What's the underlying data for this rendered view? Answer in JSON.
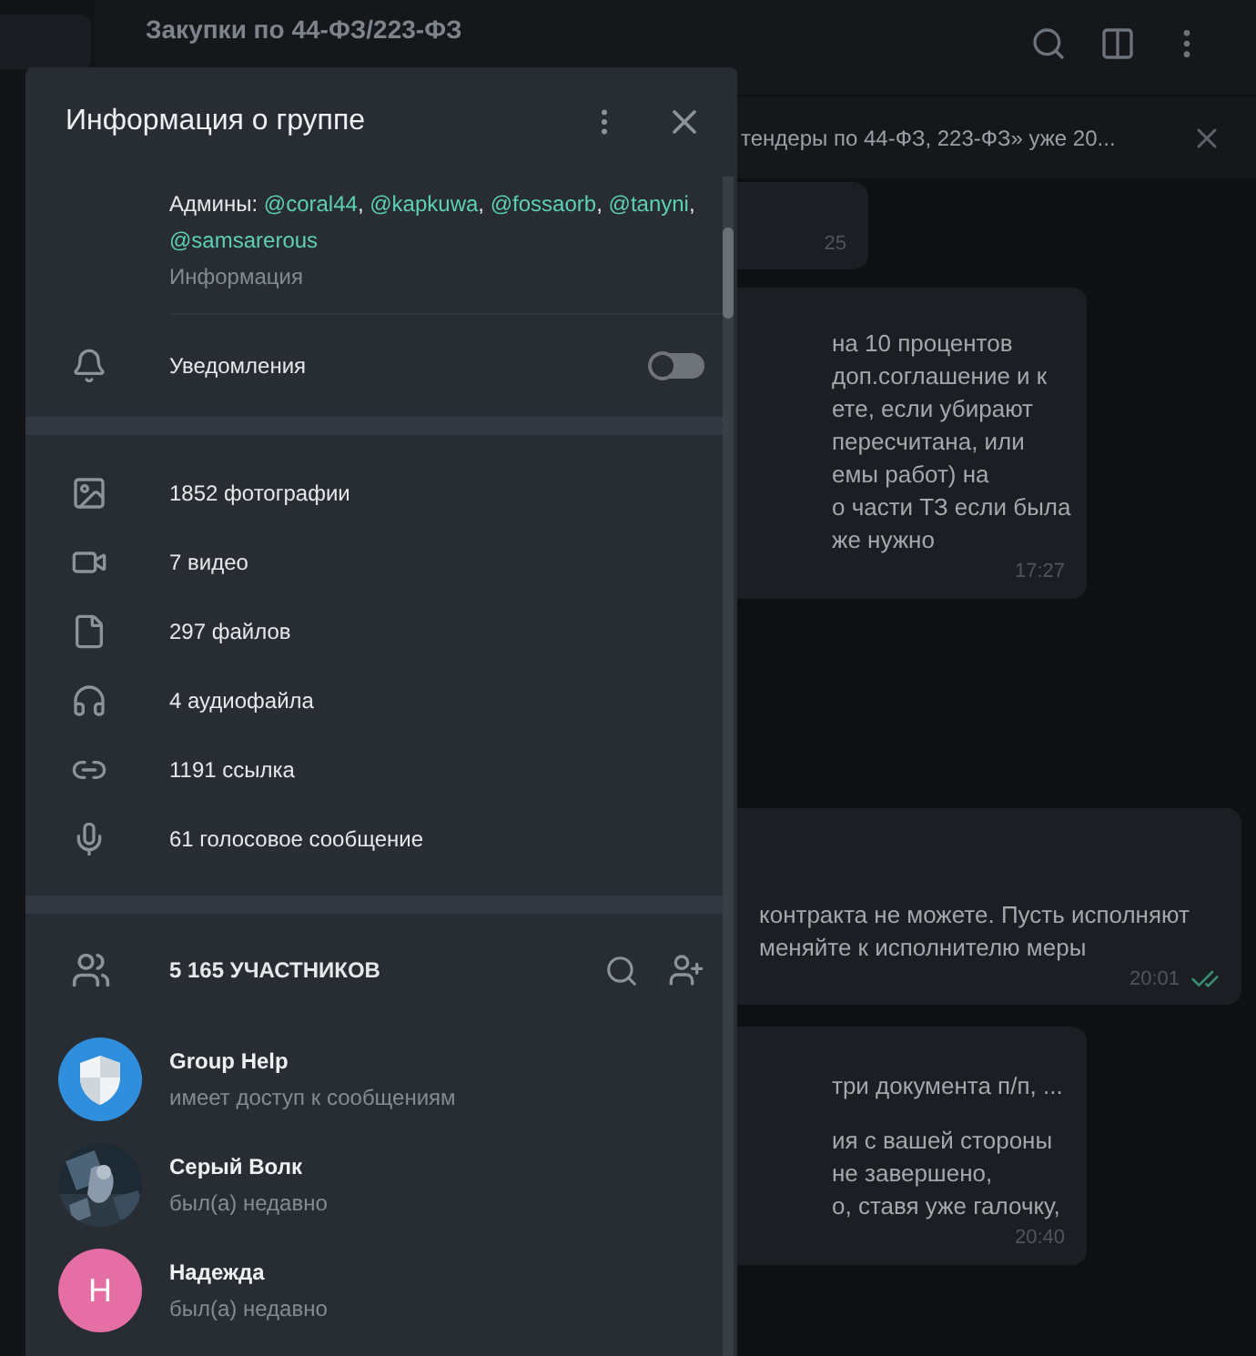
{
  "chat_header": {
    "title": "Закупки по 44-ФЗ/223-ФЗ"
  },
  "pinned": {
    "text": "тендеры по 44-ФЗ, 223-ФЗ» уже 20..."
  },
  "messages": [
    {
      "time": "25",
      "read": false
    },
    {
      "lines": [
        "на 10 процентов",
        "доп.соглашение и к",
        "ете, если убирают",
        "пересчитана, или",
        "емы работ) на",
        "о части ТЗ если была",
        "же нужно"
      ],
      "time": "17:27",
      "read": false
    },
    {
      "lines": [
        "контракта не можете. Пусть исполняют",
        "меняйте к исполнителю меры"
      ],
      "time": "20:01",
      "read": true
    },
    {
      "lines": [
        "три документа п/п, ...",
        "ия с вашей стороны",
        "не завершено,",
        "о, ставя уже галочку,"
      ],
      "time": "20:40",
      "read": false
    }
  ],
  "group_info": {
    "title": "Информация о группе",
    "admins": {
      "label": "Админы:",
      "handles": [
        "@coral44",
        "@kapkuwa",
        "@fossaorb",
        "@tanyni",
        "@samsarerous"
      ],
      "separator": ","
    },
    "info_label": "Информация",
    "notifications": {
      "label": "Уведомления",
      "on": false
    },
    "media": [
      {
        "label": "1852 фотографии"
      },
      {
        "kind": "video",
        "label": "7 видео"
      },
      {
        "kind": "file",
        "label": "297 файлов"
      },
      {
        "kind": "audio",
        "label": "4 аудиофайла"
      },
      {
        "kind": "link",
        "label": "1191 ссылка"
      },
      {
        "kind": "voice",
        "label": "61 голосовое сообщение"
      }
    ],
    "members": {
      "title": "5 165 УЧАСТНИКОВ",
      "items": [
        {
          "name": "Group Help",
          "status": "имеет доступ к сообщениям",
          "avatar": {
            "kind": "shield"
          }
        },
        {
          "name": "Серый Волк",
          "status": "был(а) недавно"
        },
        {
          "name": "Надежда",
          "status": "был(а) недавно",
          "avatar": {
            "kind": "letter",
            "letter": "Н",
            "color": "#e56fa4"
          }
        }
      ]
    }
  }
}
